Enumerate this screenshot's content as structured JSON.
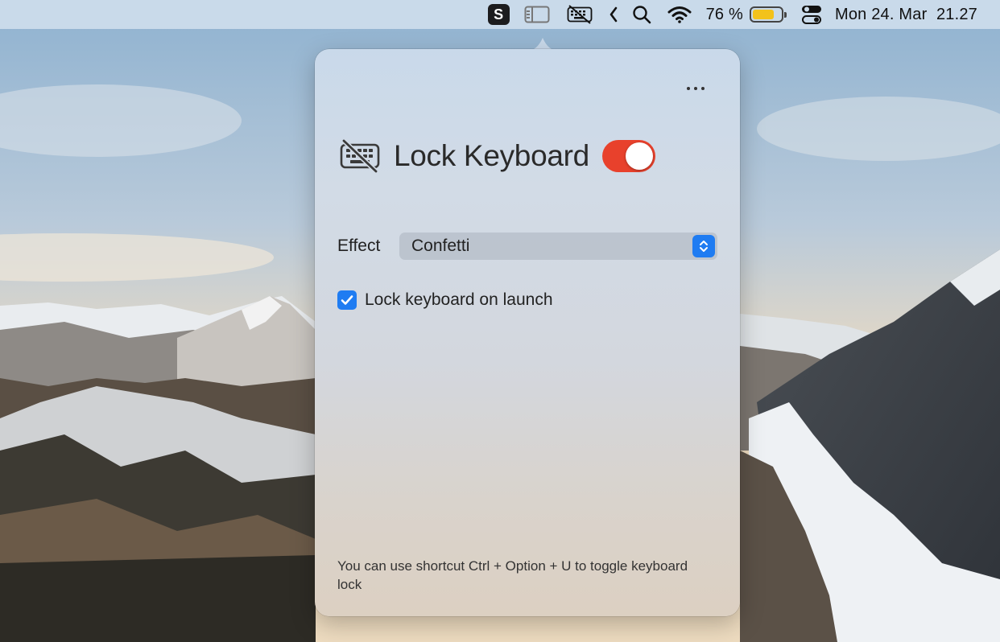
{
  "colors": {
    "accent_blue": "#1f7cf2",
    "toggle_on": "#e8412c",
    "battery_fill": "#f3c21b",
    "menubar_bg": "#cdddec"
  },
  "menubar": {
    "icons": [
      "s-app-icon",
      "sidebar-icon",
      "keyboard-lock-icon",
      "chevron-left-icon",
      "search-icon",
      "wifi-icon",
      "battery-icon",
      "control-center-icon"
    ],
    "s_app_letter": "S",
    "battery_percent_text": "76 %",
    "battery_level": 0.76,
    "datetime": "Mon 24. Mar  21.27"
  },
  "popover": {
    "more_icon": "more-icon",
    "title_icon": "keyboard-lock-icon",
    "title": "Lock Keyboard",
    "lock_enabled": true,
    "effect": {
      "label": "Effect",
      "selected": "Confetti"
    },
    "lock_on_launch": {
      "label": "Lock keyboard on launch",
      "checked": true
    },
    "hint": "You can use shortcut Ctrl + Option + U to toggle keyboard lock"
  }
}
